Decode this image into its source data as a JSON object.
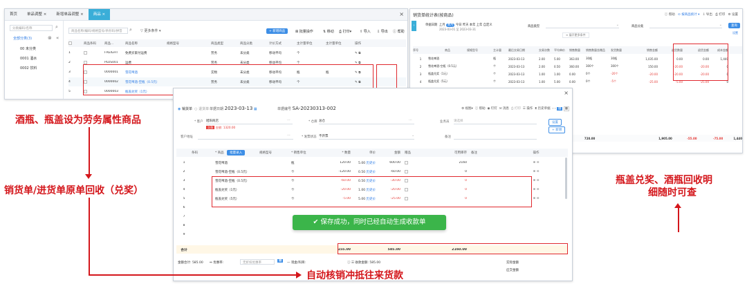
{
  "left_window": {
    "tabs": [
      "首页",
      "单品调整 ×",
      "新增单品调整 ×",
      "商品 ×"
    ],
    "search_placeholder": "分类编码/名称",
    "tree": {
      "root": "全部分类(3)",
      "items": [
        "00 未分类",
        "0001 酒水",
        "0002 饮料"
      ]
    },
    "toolbar": {
      "search_placeholder": "商品名称/编码/规格型号/条形码/拼音",
      "more_filters": "更多条件",
      "add_button": "+ 新增商品",
      "batch": "批量操作",
      "move": "移动",
      "print": "打印",
      "import": "导入",
      "export": "导出",
      "help": "帮助"
    },
    "table": {
      "columns": [
        "",
        "商品条码",
        "商品...",
        "商品名称",
        "规格型号",
        "商品类型",
        "商品分类",
        "计价方式",
        "主计量单位",
        "主计量单位",
        "操作"
      ],
      "rows": [
        {
          "no": "1",
          "code": "FREIGHT",
          "name": "免费买家付运费",
          "type": "劳务",
          "cat": "未分类",
          "price": "移动平均",
          "unit": "个"
        },
        {
          "no": "2",
          "code": "PLUS001",
          "name": "运费",
          "type": "劳务",
          "cat": "未分类",
          "price": "移动平均",
          "unit": "个"
        },
        {
          "no": "3",
          "code": "0000001",
          "name": "雪花啤酒",
          "type": "实物",
          "cat": "未分类",
          "price": "移动平均",
          "unit": "瓶",
          "unit2": "瓶"
        },
        {
          "no": "4",
          "code": "0000002",
          "name": "雪花啤酒-空瓶（0.5元）",
          "type": "劳务",
          "cat": "未分类",
          "price": "移动平均",
          "unit": "个"
        },
        {
          "no": "5",
          "code": "0000003",
          "name": "瓶盖兑奖（1元）",
          "type": "劳务",
          "cat": "未分类",
          "price": "移动平均",
          "unit": "个"
        }
      ]
    }
  },
  "right_window": {
    "title": "销货单统计表(按商品)",
    "top_links": [
      "帮助",
      "按商品统计",
      "导出",
      "打印",
      "设置"
    ],
    "filter": {
      "date_label": "单据日期",
      "date_opts": [
        "上月",
        "本月",
        "今日",
        "昨天",
        "本年",
        "上年",
        "自定义"
      ],
      "date_range": "2023-03-01 至 2023-03-31",
      "product_label": "商品类型",
      "category_label": "商品分类",
      "more": "展开更多条件",
      "query": "查询"
    },
    "columns": [
      "序号",
      "商品",
      "规格型号",
      "主计量",
      "最后交易日期",
      "交易次数",
      "平均单价",
      "销售数量",
      "销售数量含赠品",
      "发货数量",
      "销售金额",
      "退货数量",
      "退货金额",
      "成本金额"
    ],
    "rows": [
      {
        "no": "1",
        "name": "雪花啤酒",
        "unit": "瓶",
        "date": "2023-03-13",
        "times": "2.00",
        "avg": "5.00",
        "qty": "363.00",
        "qty2": "30瓶",
        "ship": "30瓶",
        "amt": "1,035.00",
        "rq": "0.00",
        "ra": "0.00",
        "cost": "1,440"
      },
      {
        "no": "2",
        "name": "雪花啤酒-空瓶（0.5元）",
        "unit": "个",
        "date": "2023-03-13",
        "times": "2.00",
        "avg": "0.50",
        "qty": "360.00",
        "qty2": "300个",
        "ship": "300个",
        "amt": "150.00",
        "rq": "-20.00",
        "ra": "-20.00",
        "cost": "0"
      },
      {
        "no": "3",
        "name": "瓶盖兑奖（1元）",
        "unit": "个",
        "date": "2023-03-13",
        "times": "1.00",
        "avg": "1.00",
        "qty": "0.00",
        "qty2": "0个",
        "ship": "-20个",
        "amt": "-20.00",
        "rq": "-20.00",
        "ra": "-20.00",
        "cost": "0"
      },
      {
        "no": "4",
        "name": "瓶盖兑奖（5元）",
        "unit": "个",
        "date": "2023-03-13",
        "times": "1.00",
        "avg": "5.00",
        "qty": "0.00",
        "qty2": "0个",
        "ship": "-5个",
        "amt": "-25.00",
        "rq": "-5.00",
        "ra": "-25.00",
        "cost": "0"
      }
    ],
    "total": {
      "label": "合计",
      "qty": "720.00",
      "amt": "1,905.00",
      "rq": "-55.00",
      "ra": "-75.00",
      "cost": "1,440"
    }
  },
  "order_window": {
    "mode_sale": "销货单",
    "mode_return": "退货单",
    "date_label": "单据日期",
    "date": "2023-03-13",
    "no_label": "单据编号",
    "no": "SA-20230313-002",
    "toolbar": [
      "视图",
      "帮助",
      "钉钉",
      "消息",
      "打印",
      "操作",
      "历史单据"
    ],
    "customer_label": "* 客户",
    "customer": "旭阳商店",
    "debt_tag": "欠款",
    "debt": "应收: 1320.00",
    "warehouse_label": "* 仓库",
    "warehouse": "总仓",
    "salesman_label": "业务员",
    "salesman_placeholder": "请选择",
    "address_label": "客户地址",
    "invoice_label": "* 发票状态",
    "invoice": "不开票",
    "remark_label": "备注",
    "side_buttons": [
      "设置",
      "+ 新增"
    ],
    "columns": [
      "序号",
      "条码",
      "* 商品",
      "规格型号",
      "* 销售单位",
      "* 数量",
      "单价",
      "金额",
      "赠品",
      "可用库存",
      "备注",
      "操作"
    ],
    "batch_btn": "批量录入",
    "lines": [
      {
        "no": "1",
        "name": "雪花啤酒",
        "unit": "瓶",
        "qty": "120.00",
        "price": "5.00",
        "price_tag": "历史价",
        "amt": "600.00",
        "stock": "2160"
      },
      {
        "no": "2",
        "name": "雪花啤酒-空瓶（0.5元）",
        "unit": "个",
        "qty": "-120.00",
        "price": "0.50",
        "price_tag": "历史价",
        "amt": "-60.00",
        "stock": "0"
      },
      {
        "no": "3",
        "name": "雪花啤酒-空瓶（0.5元）",
        "unit": "个",
        "qty": "-60.00",
        "price": "0.50",
        "price_tag": "历史价",
        "amt": "-30.00",
        "stock": "0"
      },
      {
        "no": "4",
        "name": "瓶盖兑奖（1元）",
        "unit": "个",
        "qty": "-20.00",
        "price": "1.00",
        "price_tag": "历史价",
        "amt": "-20.00",
        "stock": "0"
      },
      {
        "no": "5",
        "name": "瓶盖兑奖（5元）",
        "unit": "个",
        "qty": "-5.00",
        "price": "5.00",
        "price_tag": "历史价",
        "amt": "-25.00",
        "stock": "0"
      },
      {
        "no": "6"
      },
      {
        "no": "7"
      },
      {
        "no": "8"
      },
      {
        "no": "9"
      }
    ],
    "total": {
      "label": "合计",
      "qty": "155.00",
      "amt": "585.00",
      "stock": "2160.00"
    },
    "footer": {
      "amount_label": "金额合计: 585.00",
      "discount_label": "优惠率",
      "discount_placeholder": "无折扣优惠率",
      "receive_label": "现金/科目",
      "received_label": "收款金额: 585.00",
      "actual_label": "实际金额",
      "settle_label": "应交金额"
    },
    "toast": "保存成功，同时已经自动生成收款单"
  },
  "annotations": {
    "left_title": "酒瓶、瓶盖设为劳务属性商品",
    "left_bottom": "销货单/进货单原单回收（兑奖）",
    "right_line1": "瓶盖兑奖、酒瓶回收明",
    "right_line2": "细随时可查",
    "bottom": "自动核销冲抵往来货款"
  },
  "colors": {
    "accent": "#3aaed8",
    "annotation_red": "#d4161b",
    "toast_green": "#3bb54a"
  }
}
